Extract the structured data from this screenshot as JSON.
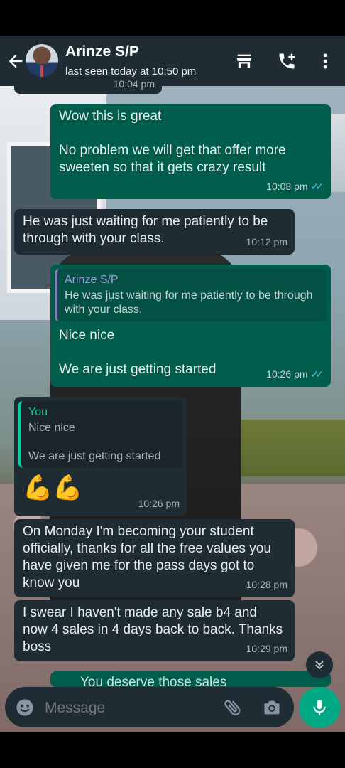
{
  "header": {
    "contact_name": "Arinze S/P",
    "status": "last seen today at 10:50 pm"
  },
  "partial_top_time": "10:04 pm",
  "messages": [
    {
      "dir": "out",
      "lines": [
        "Wow this is great",
        "",
        "No problem we will get that offer more sweeten so that it gets crazy result"
      ],
      "time": "10:08 pm",
      "read": true
    },
    {
      "dir": "in",
      "lines": [
        "He was just waiting for me patiently to be through with your class."
      ],
      "time": "10:12 pm"
    },
    {
      "dir": "out",
      "quote_name": "Arinze S/P",
      "quote_text": "He was just waiting for me patiently to be through with your class.",
      "lines": [
        "Nice nice",
        "",
        "We are just getting started"
      ],
      "time": "10:26 pm",
      "read": true
    },
    {
      "dir": "in",
      "quote_name": "You",
      "quote_text_1": "Nice nice",
      "quote_text_2": "We are just getting started",
      "lines": [
        "💪💪"
      ],
      "time": "10:26 pm"
    },
    {
      "dir": "in",
      "lines": [
        "On Monday I'm becoming your student officially, thanks for all the free values you have given me for the pass days got to know you"
      ],
      "time": "10:28 pm"
    },
    {
      "dir": "in",
      "lines": [
        "I swear I haven't made any sale b4 and now 4 sales in 4 days back to back. Thanks boss"
      ],
      "time": "10:29 pm"
    }
  ],
  "partial_bottom_text": "You deserve those sales",
  "composer": {
    "placeholder": "Message"
  },
  "colors": {
    "header": "#1f2c34",
    "outgoing": "#005c4b",
    "incoming": "#1f2c34",
    "accent": "#00a884",
    "read_ticks": "#53bdeb"
  },
  "icons": [
    "back-arrow-icon",
    "avatar",
    "store-icon",
    "call-add-icon",
    "more-vert-icon",
    "emoji-icon",
    "attach-icon",
    "camera-icon",
    "mic-icon",
    "chevron-double-down-icon"
  ]
}
